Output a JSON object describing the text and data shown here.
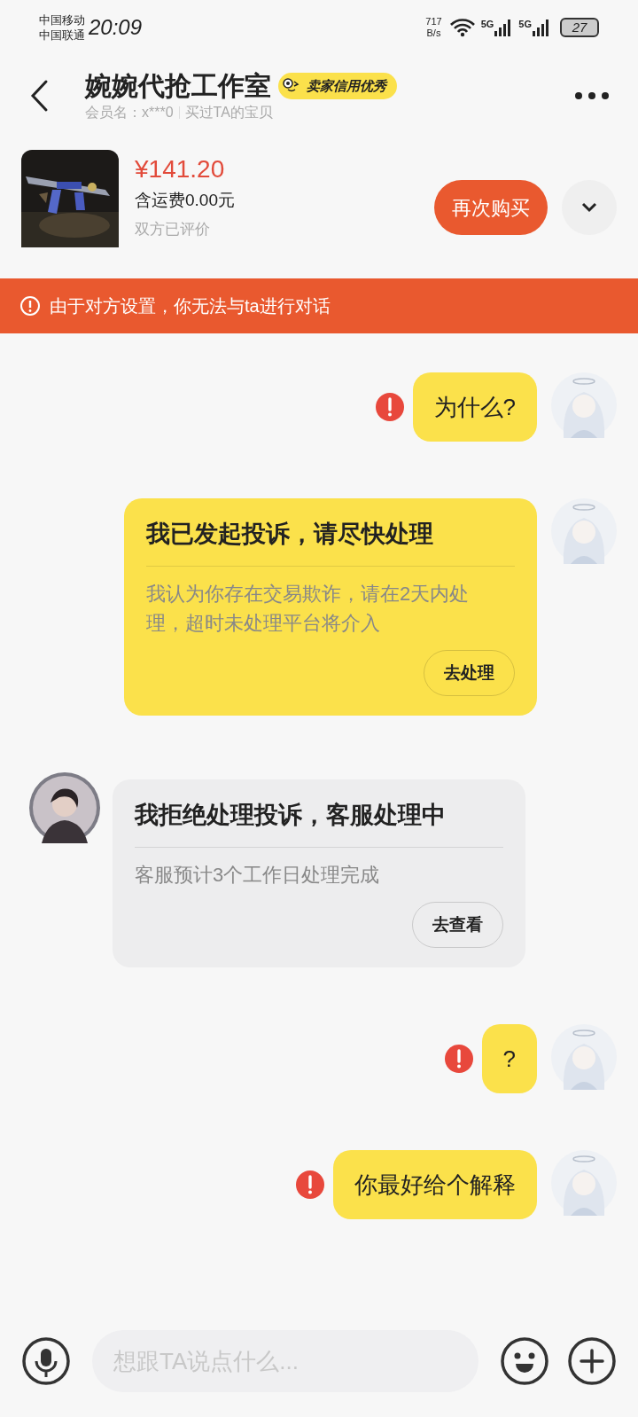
{
  "status_bar": {
    "carriers": [
      "中国移动",
      "中国联通"
    ],
    "time": "20:09",
    "net_speed": [
      "717",
      "B/s"
    ],
    "signals": [
      "5G",
      "5G"
    ],
    "battery": "27"
  },
  "header": {
    "title": "婉婉代抢工作室",
    "badge": "卖家信用优秀",
    "member": "会员名：x***0",
    "bought": "买过TA的宝贝"
  },
  "product": {
    "price": "¥141.20",
    "shipping": "含运费0.00元",
    "review": "双方已评价",
    "buy_button": "再次购买"
  },
  "notice": "由于对方设置，你无法与ta进行对话",
  "messages": [
    {
      "kind": "text",
      "outgoing": true,
      "failed": true,
      "text": "为什么?"
    },
    {
      "kind": "card",
      "outgoing": true,
      "failed": false,
      "title": "我已发起投诉，请尽快处理",
      "body": "我认为你存在交易欺诈，请在2天内处理，超时未处理平台将介入",
      "button": "去处理"
    },
    {
      "kind": "card",
      "outgoing": false,
      "failed": false,
      "title": "我拒绝处理投诉，客服处理中",
      "body": "客服预计3个工作日处理完成",
      "button": "去查看"
    },
    {
      "kind": "text",
      "outgoing": true,
      "failed": true,
      "text": "?"
    },
    {
      "kind": "text",
      "outgoing": true,
      "failed": true,
      "text": "你最好给个解释"
    }
  ],
  "input": {
    "placeholder": "想跟TA说点什么..."
  }
}
